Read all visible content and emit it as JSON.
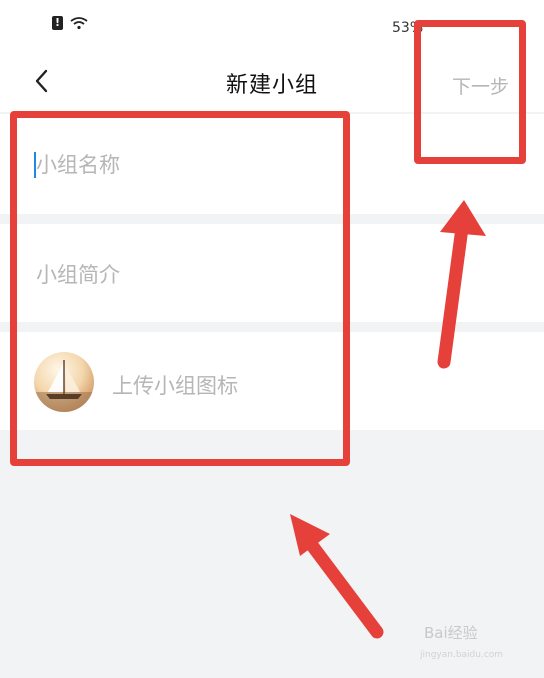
{
  "status_bar": {
    "battery": "53%"
  },
  "nav": {
    "title": "新建小组",
    "next_label": "下一步"
  },
  "form": {
    "name_placeholder": "小组名称",
    "desc_placeholder": "小组简介",
    "upload_label": "上传小组图标"
  },
  "icons": {
    "back": "chevron-left-icon",
    "sim": "sim-alert-icon",
    "wifi": "wifi-icon",
    "avatar": "sailboat-image"
  },
  "colors": {
    "annotation": "#e5413a",
    "caret": "#1e88e5",
    "placeholder": "#b6b6b6",
    "background": "#f2f3f5"
  },
  "watermark": {
    "text": "Bai经验",
    "url": "jingyan.baidu.com"
  }
}
